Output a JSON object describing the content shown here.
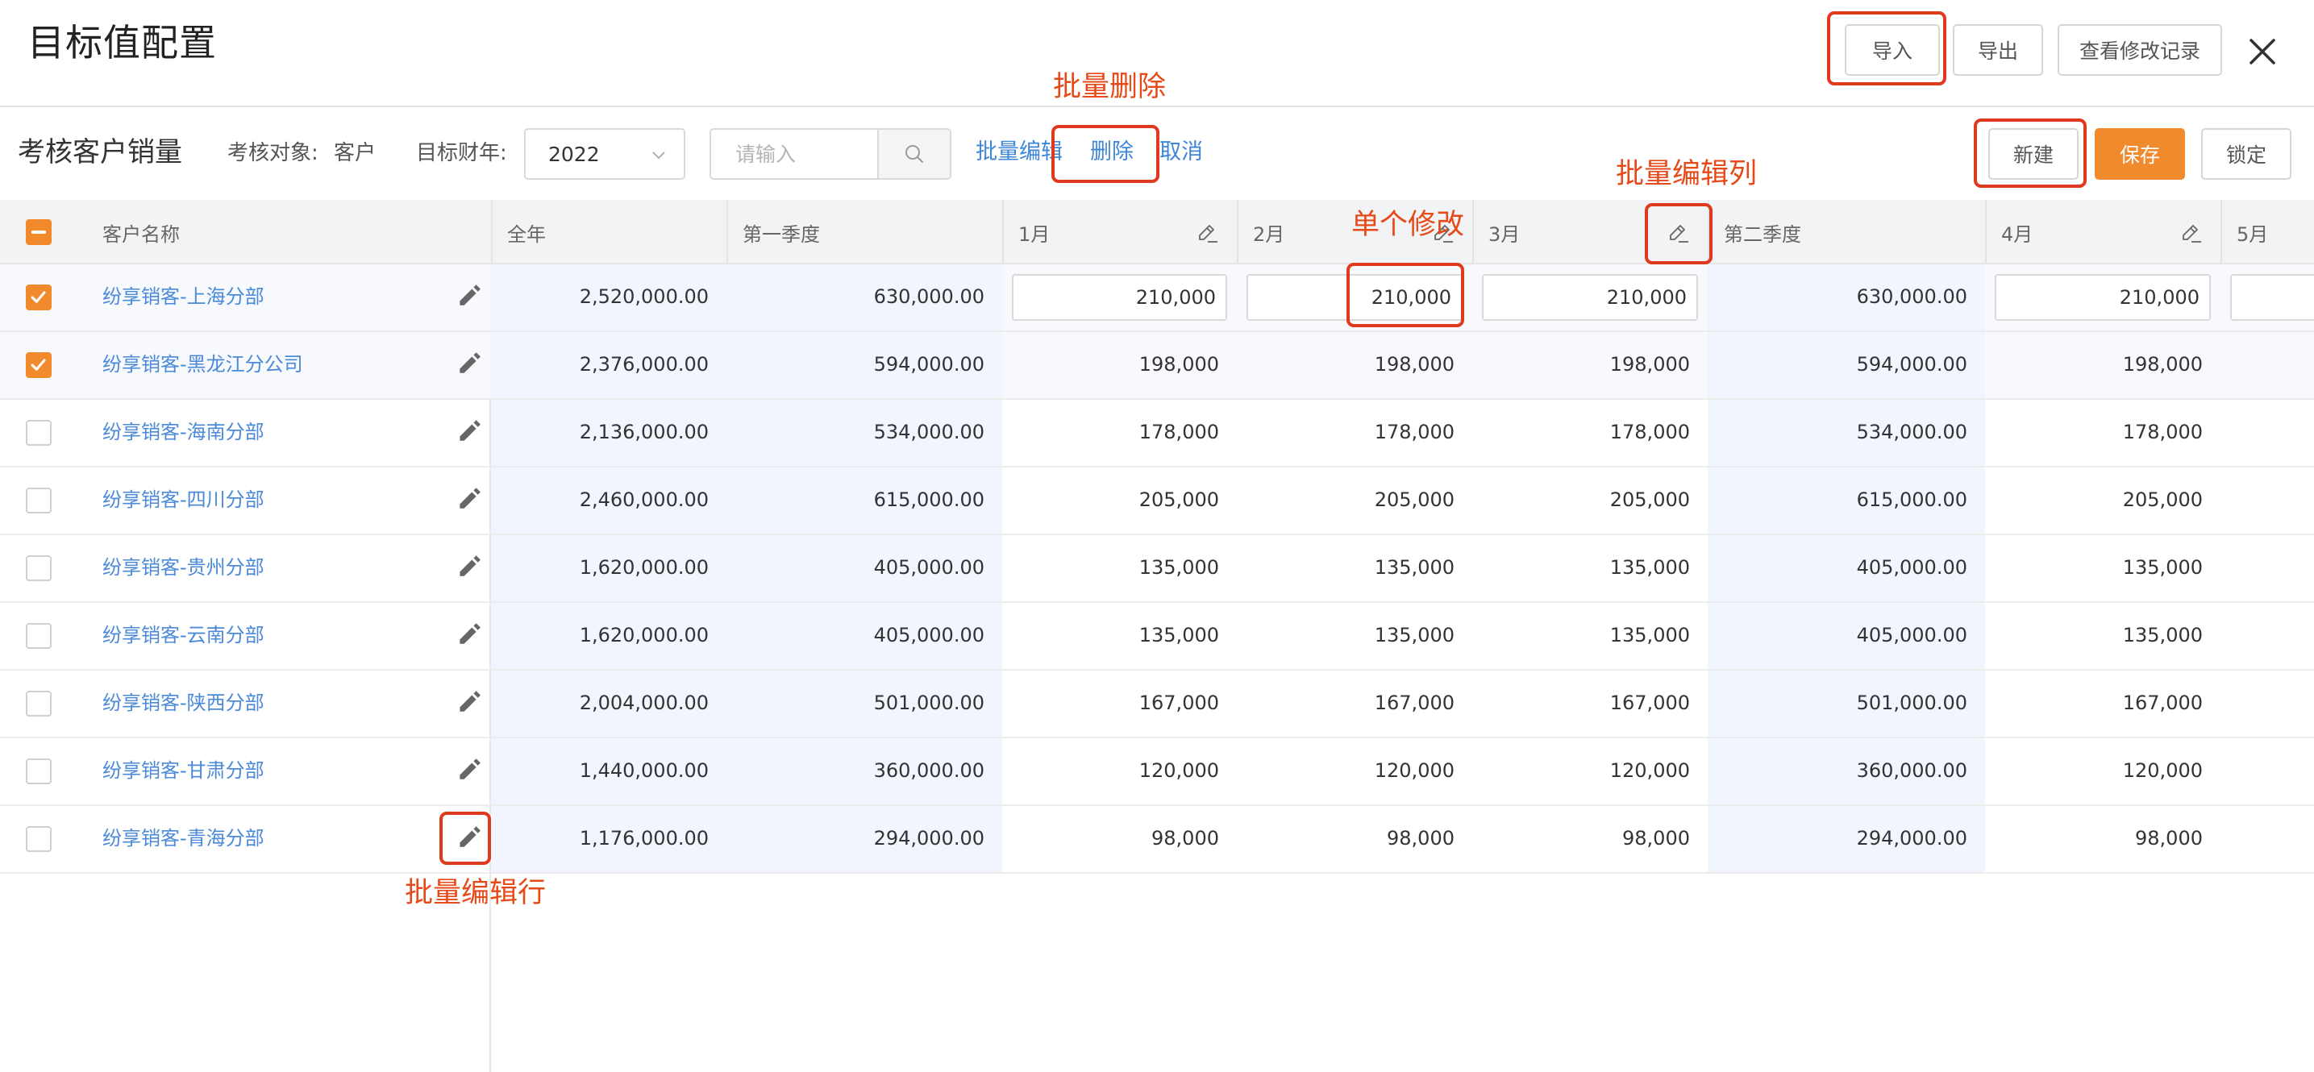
{
  "header": {
    "title": "目标值配置",
    "import_label": "导入",
    "export_label": "导出",
    "history_label": "查看修改记录"
  },
  "toolbar": {
    "title": "考核客户销量",
    "target_label": "考核对象:",
    "target_value": "客户",
    "year_label": "目标财年:",
    "year_value": "2022",
    "search_placeholder": "请输入",
    "batch_edit_label": "批量编辑",
    "delete_label": "删除",
    "cancel_label": "取消",
    "new_label": "新建",
    "save_label": "保存",
    "lock_label": "锁定"
  },
  "table": {
    "columns": [
      "客户名称",
      "全年",
      "第一季度",
      "1月",
      "2月",
      "3月",
      "第二季度",
      "4月",
      "5月"
    ],
    "rows": [
      {
        "name": "纷享销客-上海分部",
        "checked": true,
        "year": "2,520,000.00",
        "q1": "630,000.00",
        "m1": "210,000",
        "m2": "210,000",
        "m3": "210,000",
        "q2": "630,000.00",
        "m4": "210,000"
      },
      {
        "name": "纷享销客-黑龙江分公司",
        "checked": true,
        "year": "2,376,000.00",
        "q1": "594,000.00",
        "m1": "198,000",
        "m2": "198,000",
        "m3": "198,000",
        "q2": "594,000.00",
        "m4": "198,000"
      },
      {
        "name": "纷享销客-海南分部",
        "checked": false,
        "year": "2,136,000.00",
        "q1": "534,000.00",
        "m1": "178,000",
        "m2": "178,000",
        "m3": "178,000",
        "q2": "534,000.00",
        "m4": "178,000"
      },
      {
        "name": "纷享销客-四川分部",
        "checked": false,
        "year": "2,460,000.00",
        "q1": "615,000.00",
        "m1": "205,000",
        "m2": "205,000",
        "m3": "205,000",
        "q2": "615,000.00",
        "m4": "205,000"
      },
      {
        "name": "纷享销客-贵州分部",
        "checked": false,
        "year": "1,620,000.00",
        "q1": "405,000.00",
        "m1": "135,000",
        "m2": "135,000",
        "m3": "135,000",
        "q2": "405,000.00",
        "m4": "135,000"
      },
      {
        "name": "纷享销客-云南分部",
        "checked": false,
        "year": "1,620,000.00",
        "q1": "405,000.00",
        "m1": "135,000",
        "m2": "135,000",
        "m3": "135,000",
        "q2": "405,000.00",
        "m4": "135,000"
      },
      {
        "name": "纷享销客-陕西分部",
        "checked": false,
        "year": "2,004,000.00",
        "q1": "501,000.00",
        "m1": "167,000",
        "m2": "167,000",
        "m3": "167,000",
        "q2": "501,000.00",
        "m4": "167,000"
      },
      {
        "name": "纷享销客-甘肃分部",
        "checked": false,
        "year": "1,440,000.00",
        "q1": "360,000.00",
        "m1": "120,000",
        "m2": "120,000",
        "m3": "120,000",
        "q2": "360,000.00",
        "m4": "120,000"
      },
      {
        "name": "纷享销客-青海分部",
        "checked": false,
        "year": "1,176,000.00",
        "q1": "294,000.00",
        "m1": "98,000",
        "m2": "98,000",
        "m3": "98,000",
        "q2": "294,000.00",
        "m4": "98,000"
      }
    ]
  },
  "annotations": {
    "batch_delete": "批量删除",
    "batch_edit_column": "批量编辑列",
    "single_edit": "单个修改",
    "batch_edit_row": "批量编辑行"
  },
  "colors": {
    "accent": "#f08a2c",
    "link": "#3e86d8",
    "annotation": "#e03a1e"
  }
}
